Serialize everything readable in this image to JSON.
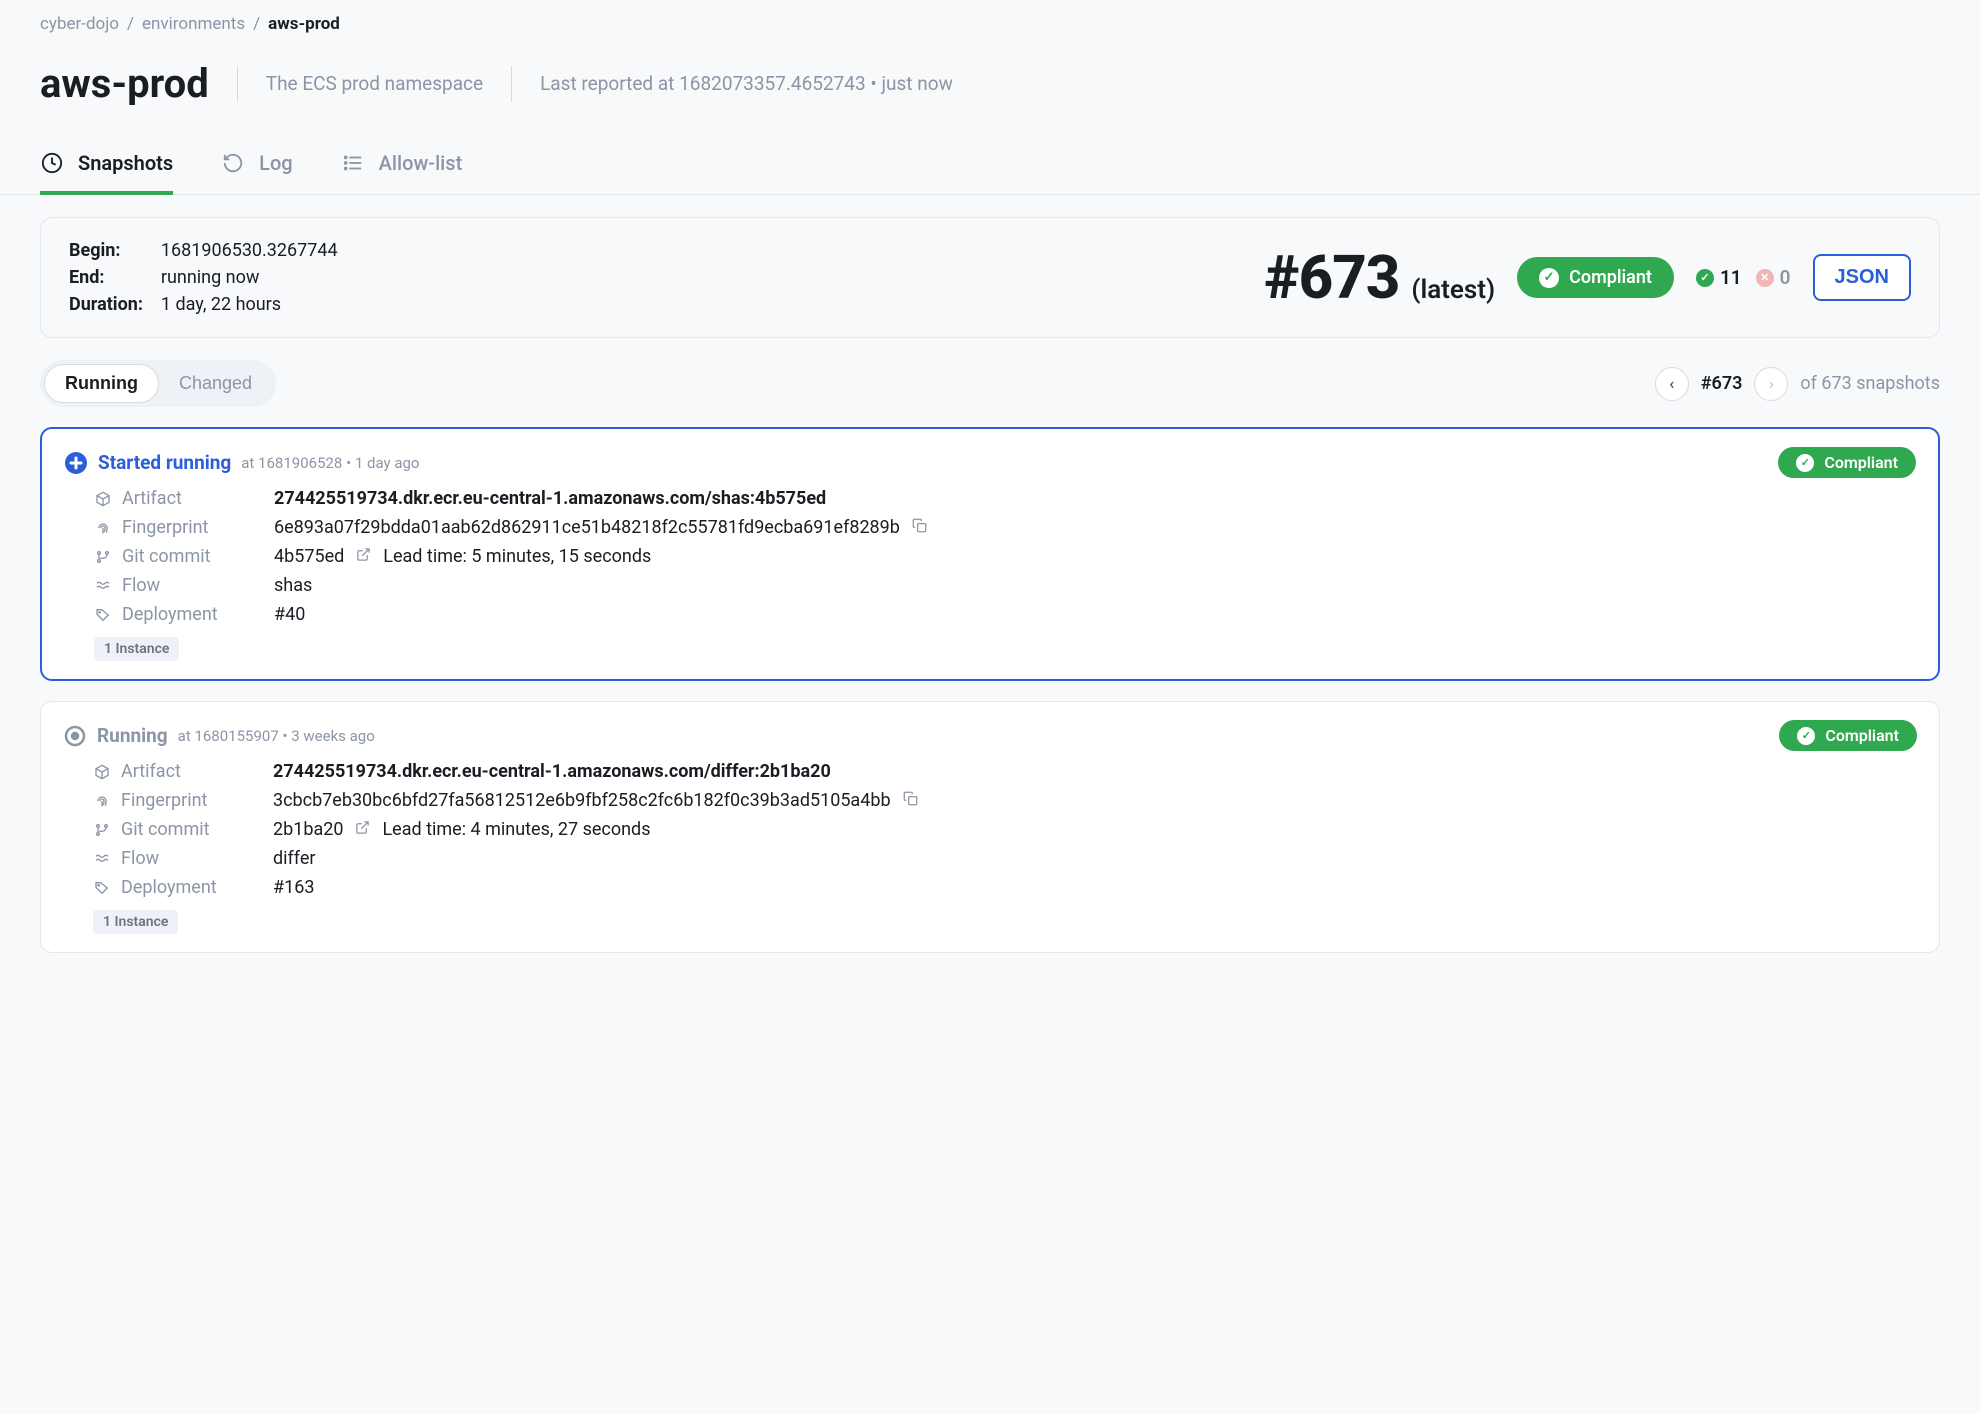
{
  "breadcrumb": {
    "org": "cyber-dojo",
    "section": "environments",
    "current": "aws-prod"
  },
  "header": {
    "title": "aws-prod",
    "subtitle": "The ECS prod namespace",
    "last_reported": "Last reported at 1682073357.4652743 • just now"
  },
  "tabs": {
    "snapshots": "Snapshots",
    "log": "Log",
    "allowlist": "Allow-list"
  },
  "summary": {
    "begin_label": "Begin:",
    "begin_value": "1681906530.3267744",
    "end_label": "End:",
    "end_value": "running now",
    "duration_label": "Duration:",
    "duration_value": "1 day, 22 hours",
    "snapshot_number": "#673",
    "latest_label": "(latest)",
    "compliant": "Compliant",
    "count_ok": "11",
    "count_fail": "0",
    "json_button": "JSON"
  },
  "filters": {
    "running": "Running",
    "changed": "Changed",
    "pager_pos": "#673",
    "pager_total": "of 673 snapshots"
  },
  "cards": [
    {
      "status_title": "Started running",
      "status_color": "blue",
      "meta": "at 1681906528 • 1 day ago",
      "compliant": "Compliant",
      "artifact": "274425519734.dkr.ecr.eu-central-1.amazonaws.com/shas:4b575ed",
      "fingerprint": "6e893a07f29bdda01aab62d862911ce51b48218f2c55781fd9ecba691ef8289b",
      "git_commit": "4b575ed",
      "lead_time": "Lead time: 5 minutes, 15 seconds",
      "flow": "shas",
      "deployment": "#40",
      "instances": "1 Instance"
    },
    {
      "status_title": "Running",
      "status_color": "gray",
      "meta": "at 1680155907 • 3 weeks ago",
      "compliant": "Compliant",
      "artifact": "274425519734.dkr.ecr.eu-central-1.amazonaws.com/differ:2b1ba20",
      "fingerprint": "3cbcb7eb30bc6bfd27fa56812512e6b9fbf258c2fc6b182f0c39b3ad5105a4bb",
      "git_commit": "2b1ba20",
      "lead_time": "Lead time: 4 minutes, 27 seconds",
      "flow": "differ",
      "deployment": "#163",
      "instances": "1 Instance"
    }
  ],
  "labels": {
    "artifact": "Artifact",
    "fingerprint": "Fingerprint",
    "git_commit": "Git commit",
    "flow": "Flow",
    "deployment": "Deployment"
  }
}
